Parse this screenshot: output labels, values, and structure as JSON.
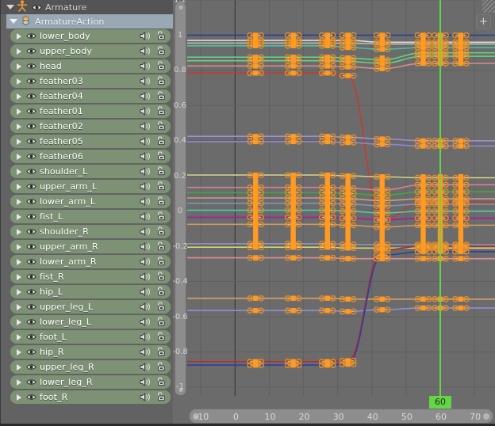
{
  "app": {
    "editor": "Graph Editor",
    "corner_plus_label": "+"
  },
  "channels": {
    "object": {
      "label": "Armature",
      "icon": "armature-icon",
      "expand": "triangle-down-icon",
      "visibility": "eye-icon"
    },
    "action": {
      "label": "ArmatureAction",
      "icon": "action-icon",
      "expand": "triangle-down-icon"
    },
    "mute_icon": "speaker-icon",
    "lock_icon": "unlocked-padlock-icon",
    "expand_icon": "triangle-right-icon",
    "visibility_icon": "eye-icon",
    "items": [
      {
        "label": "lower_body"
      },
      {
        "label": "upper_body"
      },
      {
        "label": "head"
      },
      {
        "label": "feather03"
      },
      {
        "label": "feather04"
      },
      {
        "label": "feather01"
      },
      {
        "label": "feather02"
      },
      {
        "label": "feather05"
      },
      {
        "label": "feather06"
      },
      {
        "label": "shoulder_L"
      },
      {
        "label": "upper_arm_L"
      },
      {
        "label": "lower_arm_L"
      },
      {
        "label": "fist_L"
      },
      {
        "label": "shoulder_R"
      },
      {
        "label": "upper_arm_R"
      },
      {
        "label": "lower_arm_R"
      },
      {
        "label": "fist_R"
      },
      {
        "label": "hip_L"
      },
      {
        "label": "upper_leg_L"
      },
      {
        "label": "lower_leg_L"
      },
      {
        "label": "foot_L"
      },
      {
        "label": "hip_R"
      },
      {
        "label": "upper_leg_R"
      },
      {
        "label": "lower_leg_R"
      },
      {
        "label": "foot_R"
      }
    ]
  },
  "playhead": {
    "frame_label": "60",
    "frame": 60,
    "color": "#63d647"
  },
  "colors": {
    "graph_background": "#6b6b6b",
    "grid": "#606060",
    "channel_background": "#626262",
    "fcurve_row": "#7d9175",
    "action_row": "#9aa7b5",
    "keyframe_selected": "#ff9a22",
    "handle": "#e58b20"
  },
  "chart_data": {
    "type": "line",
    "title": "",
    "xlabel": "",
    "ylabel": "",
    "xlim": [
      -14,
      76
    ],
    "ylim": [
      -1.05,
      1.2
    ],
    "grid": true,
    "legend": "none",
    "x_ticks": [
      -10,
      0,
      10,
      20,
      30,
      40,
      50,
      60,
      70
    ],
    "y_ticks": [
      1.2,
      1.0,
      0.8,
      0.6,
      0.4,
      0.2,
      -0.0,
      -0.2,
      -0.4,
      -0.6,
      -0.8,
      -1.0
    ],
    "keyframe_columns": [
      6,
      17,
      27,
      33,
      43,
      55,
      60,
      66
    ],
    "series": [
      {
        "name": "lower_body_rot_w",
        "color": "#2c3f8e",
        "x": [
          6,
          17,
          27,
          33,
          43,
          55,
          60,
          66
        ],
        "values": [
          1.0,
          1.0,
          1.0,
          1.0,
          1.0,
          1.0,
          1.0,
          1.0
        ]
      },
      {
        "name": "lower_body_loc_z",
        "color": "#dadada",
        "x": [
          6,
          17,
          27,
          33,
          43,
          55,
          60,
          66
        ],
        "values": [
          0.97,
          0.97,
          0.97,
          0.97,
          0.96,
          0.96,
          0.96,
          0.96
        ]
      },
      {
        "name": "upper_body_scale",
        "color": "#bdbdbd",
        "x": [
          6,
          17,
          27,
          33,
          43,
          55,
          60,
          66
        ],
        "values": [
          0.955,
          0.955,
          0.955,
          0.955,
          0.95,
          0.95,
          0.95,
          0.95
        ]
      },
      {
        "name": "upper_body_rot",
        "color": "#4fbf9a",
        "x": [
          6,
          17,
          27,
          33,
          43,
          55,
          60,
          66
        ],
        "values": [
          0.94,
          0.94,
          0.94,
          0.93,
          0.92,
          0.93,
          0.93,
          0.93
        ]
      },
      {
        "name": "head_rot_w",
        "color": "#5fd08a",
        "x": [
          6,
          17,
          27,
          33,
          43,
          55,
          60,
          66
        ],
        "values": [
          0.875,
          0.875,
          0.875,
          0.87,
          0.86,
          0.9,
          0.9,
          0.9
        ]
      },
      {
        "name": "head_rot_x",
        "color": "#6fd07a",
        "x": [
          6,
          17,
          27,
          33,
          43,
          55,
          60,
          66
        ],
        "values": [
          0.855,
          0.855,
          0.855,
          0.85,
          0.84,
          0.88,
          0.88,
          0.88
        ]
      },
      {
        "name": "feather03_rot",
        "color": "#d88b8b",
        "x": [
          6,
          17,
          27,
          33,
          43,
          55,
          60,
          66
        ],
        "values": [
          0.825,
          0.825,
          0.825,
          0.82,
          0.81,
          0.84,
          0.84,
          0.84
        ]
      },
      {
        "name": "feather04_rot",
        "color": "#c33b2e",
        "x": [
          6,
          17,
          27,
          33,
          43,
          55,
          60,
          66
        ],
        "values": [
          0.785,
          0.785,
          0.785,
          0.77,
          -0.05,
          0.05,
          0.05,
          0.05
        ]
      },
      {
        "name": "feather01_rot",
        "color": "#9b8fd6",
        "x": [
          6,
          17,
          27,
          33,
          43,
          55,
          60,
          66
        ],
        "values": [
          0.425,
          0.425,
          0.425,
          0.42,
          0.41,
          0.4,
          0.4,
          0.4
        ]
      },
      {
        "name": "feather02_rot",
        "color": "#8f86d0",
        "x": [
          6,
          17,
          27,
          33,
          43,
          55,
          60,
          66
        ],
        "values": [
          0.395,
          0.395,
          0.395,
          0.39,
          0.38,
          0.37,
          0.37,
          0.37
        ]
      },
      {
        "name": "feather05_rot",
        "color": "#cfcf8a",
        "x": [
          6,
          17,
          27,
          33,
          43,
          55,
          60,
          66
        ],
        "values": [
          0.205,
          0.205,
          0.205,
          0.2,
          0.195,
          0.19,
          0.19,
          0.19
        ]
      },
      {
        "name": "feather06_rot",
        "color": "#d87f92",
        "x": [
          6,
          17,
          27,
          33,
          43,
          55,
          60,
          66
        ],
        "values": [
          0.135,
          0.135,
          0.135,
          0.13,
          0.12,
          0.15,
          0.15,
          0.15
        ]
      },
      {
        "name": "shoulder_L_rot",
        "color": "#3fa83f",
        "x": [
          6,
          17,
          27,
          33,
          43,
          55,
          60,
          66
        ],
        "values": [
          0.105,
          0.105,
          0.105,
          0.1,
          0.09,
          0.11,
          0.11,
          0.11
        ]
      },
      {
        "name": "upper_arm_L_rot",
        "color": "#c4a08f",
        "x": [
          6,
          17,
          27,
          33,
          43,
          55,
          60,
          66
        ],
        "values": [
          0.075,
          0.075,
          0.075,
          0.07,
          0.06,
          0.07,
          0.07,
          0.07
        ]
      },
      {
        "name": "lower_arm_L_rot",
        "color": "#7e96b5",
        "x": [
          6,
          17,
          27,
          33,
          43,
          55,
          60,
          66
        ],
        "values": [
          0.045,
          0.045,
          0.045,
          0.04,
          0.03,
          0.04,
          0.04,
          0.04
        ]
      },
      {
        "name": "fist_L_rot",
        "color": "#4fd0b0",
        "x": [
          6,
          17,
          27,
          33,
          43,
          55,
          60,
          66
        ],
        "values": [
          0.005,
          0.005,
          0.005,
          0.0,
          -0.01,
          0.0,
          0.0,
          0.0
        ]
      },
      {
        "name": "shoulder_R_rot",
        "color": "#a21ea2",
        "x": [
          6,
          17,
          27,
          33,
          43,
          55,
          60,
          66
        ],
        "values": [
          -0.035,
          -0.035,
          -0.035,
          -0.04,
          -0.05,
          -0.04,
          -0.04,
          -0.04
        ]
      },
      {
        "name": "upper_arm_R_rot",
        "color": "#c99b6a",
        "x": [
          6,
          17,
          27,
          33,
          43,
          55,
          60,
          66
        ],
        "values": [
          -0.075,
          -0.075,
          -0.075,
          -0.08,
          -0.09,
          -0.08,
          -0.08,
          -0.08
        ]
      },
      {
        "name": "lower_arm_R_rot",
        "color": "#8f8fc4",
        "x": [
          6,
          17,
          27,
          33,
          43,
          55,
          60,
          66
        ],
        "values": [
          -0.185,
          -0.185,
          -0.185,
          -0.19,
          -0.19,
          -0.19,
          -0.19,
          -0.19
        ]
      },
      {
        "name": "fist_R_rot",
        "color": "#d8d86a",
        "x": [
          6,
          17,
          27,
          33,
          43,
          55,
          60,
          66
        ],
        "values": [
          -0.205,
          -0.205,
          -0.205,
          -0.21,
          -0.21,
          -0.21,
          -0.21,
          -0.21
        ]
      },
      {
        "name": "hip_L_rot",
        "color": "#e08f8f",
        "x": [
          6,
          17,
          27,
          33,
          43,
          55,
          60,
          66
        ],
        "values": [
          -0.265,
          -0.265,
          -0.265,
          -0.27,
          -0.27,
          -0.27,
          -0.27,
          -0.27
        ]
      },
      {
        "name": "upper_leg_L_rot",
        "color": "#d9a06a",
        "x": [
          6,
          17,
          27,
          33,
          43,
          55,
          60,
          66
        ],
        "values": [
          -0.495,
          -0.495,
          -0.495,
          -0.5,
          -0.5,
          -0.5,
          -0.5,
          -0.5
        ]
      },
      {
        "name": "lower_leg_L_rot",
        "color": "#8f8fd8",
        "x": [
          6,
          17,
          27,
          33,
          43,
          55,
          60,
          66
        ],
        "values": [
          -0.565,
          -0.565,
          -0.565,
          -0.57,
          -0.56,
          -0.55,
          -0.55,
          -0.55
        ]
      },
      {
        "name": "foot_L_rot",
        "color": "#b03030",
        "x": [
          6,
          17,
          27,
          33,
          43,
          55,
          60,
          66
        ],
        "values": [
          -0.855,
          -0.855,
          -0.855,
          -0.85,
          -0.22,
          -0.2,
          -0.2,
          -0.2
        ]
      },
      {
        "name": "foot_R_rot",
        "color": "#2c3f9e",
        "x": [
          6,
          17,
          27,
          33,
          43,
          55,
          60,
          66
        ],
        "values": [
          -0.875,
          -0.875,
          -0.875,
          -0.87,
          -0.25,
          -0.23,
          -0.23,
          -0.23
        ]
      }
    ]
  }
}
